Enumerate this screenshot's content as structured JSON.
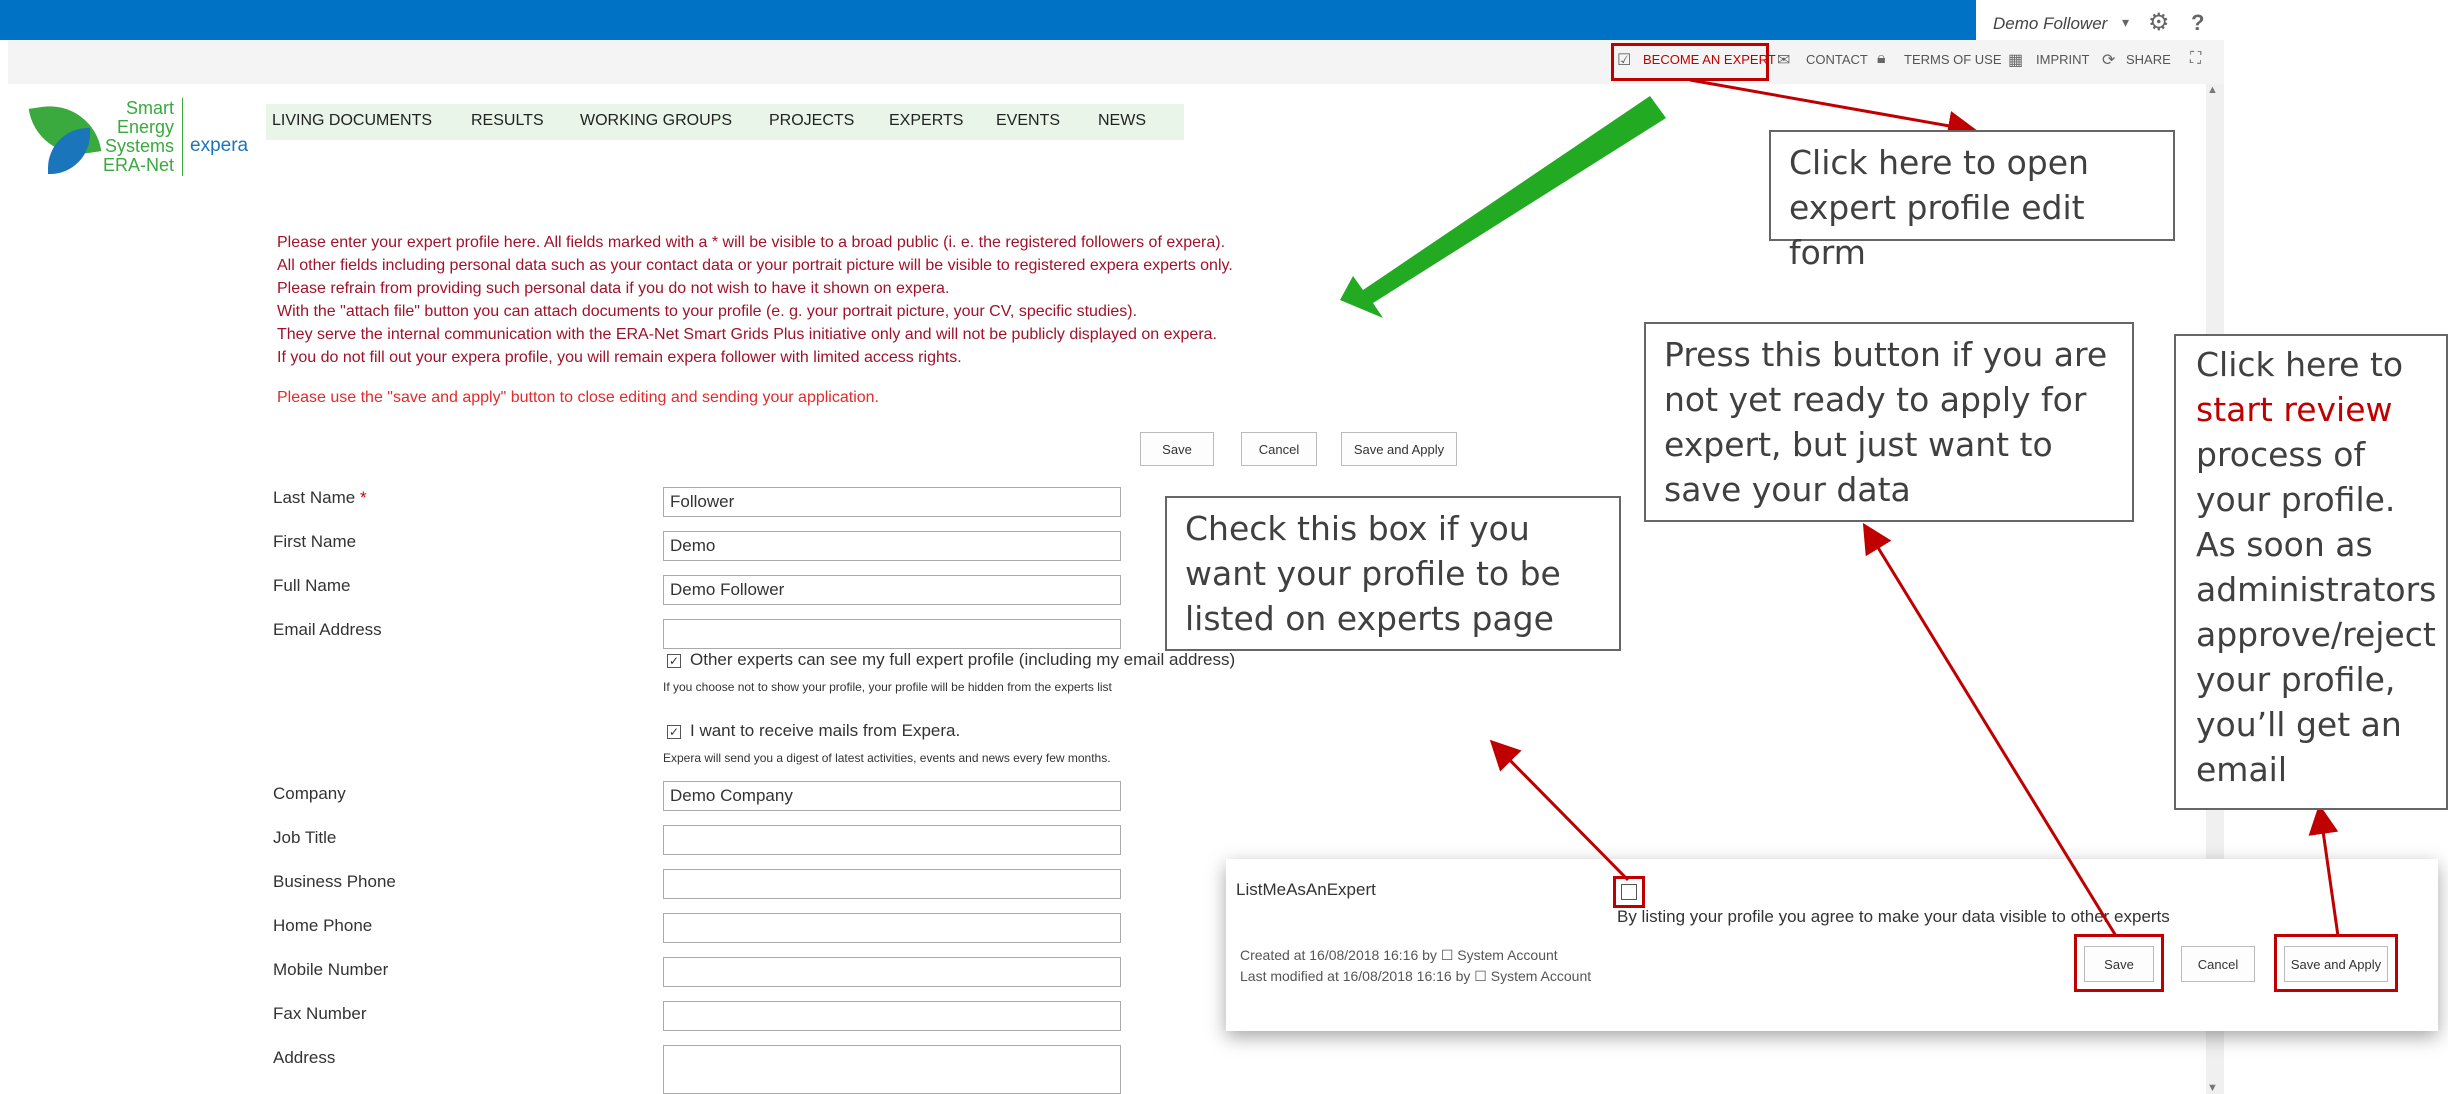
{
  "suite_bar": {
    "user_name": "Demo Follower",
    "user_caret": "▾",
    "settings_icon": "gear-icon",
    "help_label": "?"
  },
  "ribbon": {
    "become_expert": "BECOME AN EXPERT",
    "contact": "CONTACT",
    "terms": "TERMS OF USE",
    "imprint": "IMPRINT",
    "share": "SHARE",
    "focus_icon": "focus-icon"
  },
  "logo": {
    "line1": "Smart",
    "line2": "Energy",
    "line3": "Systems",
    "line4": "ERA-Net",
    "brand": "expera",
    "colors": {
      "green": "#3aa93e",
      "blue": "#1b75bb"
    }
  },
  "nav": {
    "items": [
      "LIVING DOCUMENTS",
      "RESULTS",
      "WORKING GROUPS",
      "PROJECTS",
      "EXPERTS",
      "EVENTS",
      "NEWS"
    ]
  },
  "intro": {
    "lines": [
      "Please enter your expert profile here. All fields marked with a * will be visible to a broad public (i. e. the registered followers of expera).",
      "All other fields including personal data such as your contact data or your portrait picture will be visible to registered expera experts only.",
      "Please refrain from providing such personal data if you do not wish to have it shown on expera.",
      "With the \"attach file\" button you can attach documents to your profile (e. g. your portrait picture, your CV, specific studies).",
      "They serve the internal communication with the ERA-Net Smart Grids Plus initiative only and will not be publicly displayed on expera.",
      "If you do not fill out your expera profile, you will remain expera follower with limited access rights."
    ],
    "save_note": "Please use the \"save and apply\" button to close editing and sending your application."
  },
  "top_buttons": {
    "save": "Save",
    "cancel": "Cancel",
    "save_apply": "Save and Apply"
  },
  "form": {
    "last_name": {
      "label": "Last Name",
      "required_mark": "*",
      "value": "Follower"
    },
    "first_name": {
      "label": "First Name",
      "value": "Demo"
    },
    "full_name": {
      "label": "Full Name",
      "value": "Demo Follower"
    },
    "email": {
      "label": "Email Address",
      "value": ""
    },
    "show_profile": {
      "checked": true,
      "check_glyph": "✓",
      "label": "Other experts can see my full expert profile (including my email address)",
      "hint": "If you choose not to show your profile, your profile will be hidden from the experts list"
    },
    "receive_mails": {
      "checked": true,
      "check_glyph": "✓",
      "label": "I want to receive mails from Expera.",
      "hint": "Expera will send you a digest of latest activities, events and news every few months."
    },
    "company": {
      "label": "Company",
      "value": "Demo Company"
    },
    "job_title": {
      "label": "Job Title",
      "value": ""
    },
    "business_phone": {
      "label": "Business Phone",
      "value": ""
    },
    "home_phone": {
      "label": "Home Phone",
      "value": ""
    },
    "mobile_number": {
      "label": "Mobile Number",
      "value": ""
    },
    "fax_number": {
      "label": "Fax Number",
      "value": ""
    },
    "address": {
      "label": "Address",
      "value": ""
    }
  },
  "callouts": {
    "open_form": "Click here to open expert profile edit form",
    "check_box": "Check this box if you want your profile to be listed on experts page",
    "save_only": "Press this button if you are not yet ready to apply for expert, but just want to save your data",
    "review_before": "Click here to",
    "review_highlight": "start review",
    "review_after": "process of your profile. As soon as administrators approve/reject your profile, you’ll get an email"
  },
  "popup": {
    "field_name": "ListMeAsAnExpert",
    "agree_text": "By listing your profile you agree to make your data visible to other experts",
    "created": "Created at 16/08/2018 16:16 by",
    "modified": "Last modified at 16/08/2018 16:16 by",
    "account": "System Account",
    "save": "Save",
    "cancel": "Cancel",
    "save_apply": "Save and Apply"
  },
  "colors": {
    "suite_blue": "#0072c6",
    "annotation_red": "#c00000",
    "arrow_green": "#22aa22",
    "intro_text": "#a0122a"
  }
}
